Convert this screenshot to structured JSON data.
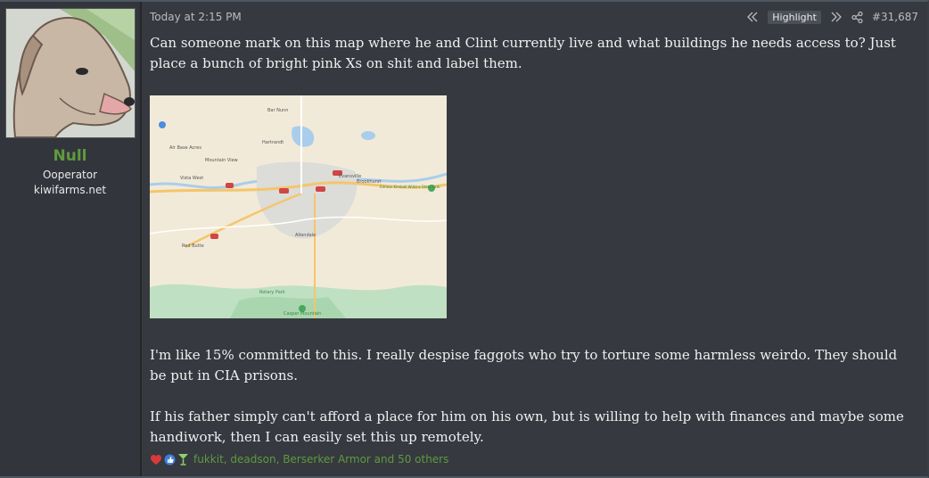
{
  "user": {
    "name": "Null",
    "title": "Ooperator",
    "banner": "kiwifarms.net"
  },
  "post": {
    "timestamp": "Today at 2:15 PM",
    "highlight_label": "Highlight",
    "post_number": "#31,687",
    "paragraph1": "Can someone mark on this map where he and Clint currently live and what buildings he needs access to? Just place a bunch of bright pink Xs on shit and label them.",
    "paragraph2": "I'm like 15% committed to this. I really despise faggots who try to torture some harmless weirdo. They should be put in CIA prisons.",
    "paragraph3": "If his father simply can't afford a place for him on his own, but is willing to help with finances and maybe some handiwork, then I can easily set this up remotely."
  },
  "map": {
    "labels": {
      "bar_nunn": "Bar Nunn",
      "hartrandt": "Hartrandt",
      "air_base_acres": "Air Base Acres",
      "mountain_view": "Mountain View",
      "vista_west": "Vista West",
      "red_butte": "Red Butte",
      "brookhurst": "Brookhurst",
      "evansville": "Evansville",
      "allendale": "Allendale",
      "edness": "Edness Kimball Wilkins State Park",
      "rotary_park": "Rotary Park",
      "casper_mountain": "Casper Mountain"
    }
  },
  "reactions": {
    "users_text": "fukkit, deadson, Berserker Armor and 50 others"
  },
  "colors": {
    "username": "#5f9a3c",
    "background": "#363940"
  }
}
